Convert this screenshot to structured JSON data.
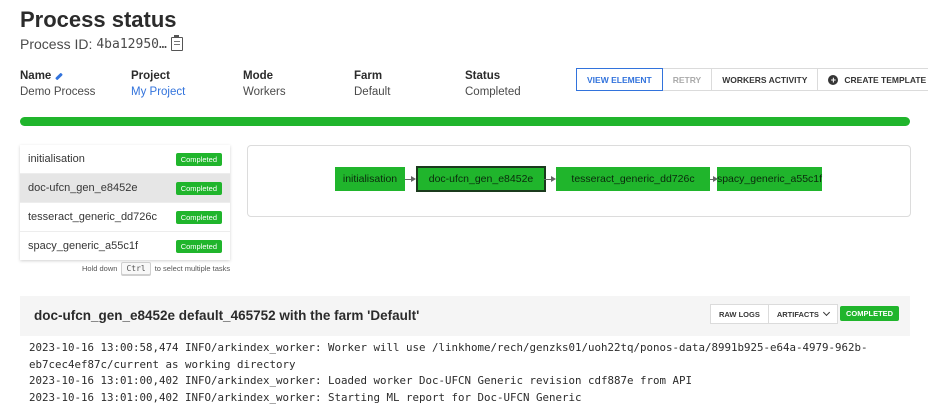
{
  "header": {
    "title": "Process status",
    "process_id_label": "Process ID:",
    "process_id": "4ba12950…"
  },
  "meta": {
    "name_label": "Name",
    "name_value": "Demo Process",
    "project_label": "Project",
    "project_value": "My Project",
    "mode_label": "Mode",
    "mode_value": "Workers",
    "farm_label": "Farm",
    "farm_value": "Default",
    "status_label": "Status",
    "status_value": "Completed"
  },
  "toolbar": {
    "view_element": "VIEW ELEMENT",
    "retry": "RETRY",
    "workers_activity": "WORKERS ACTIVITY",
    "create_template": "CREATE TEMPLATE"
  },
  "progress": {
    "value": 1.0,
    "color": "#20b52c"
  },
  "tasks": [
    {
      "name": "initialisation",
      "status": "Completed",
      "selected": false
    },
    {
      "name": "doc-ufcn_gen_e8452e",
      "status": "Completed",
      "selected": true
    },
    {
      "name": "tesseract_generic_dd726c",
      "status": "Completed",
      "selected": false
    },
    {
      "name": "spacy_generic_a55c1f",
      "status": "Completed",
      "selected": false
    }
  ],
  "hint": {
    "before": "Hold down",
    "key": "Ctrl",
    "after": "to select multiple tasks"
  },
  "graph": {
    "nodes": [
      "initialisation",
      "doc-ufcn_gen_e8452e",
      "tesseract_generic_dd726c",
      "spacy_generic_a55c1f"
    ]
  },
  "log": {
    "title": "doc-ufcn_gen_e8452e default_465752 with the farm 'Default'",
    "raw_logs": "RAW LOGS",
    "artifacts": "ARTIFACTS",
    "status": "COMPLETED",
    "lines": [
      "2023-10-16 13:00:58,474 INFO/arkindex_worker: Worker will use /linkhome/rech/genzks01/uoh22tq/ponos-data/8991b925-e64a-4979-962b-",
      "eb7cec4ef87c/current as working directory",
      "2023-10-16 13:01:00,402 INFO/arkindex_worker: Loaded worker Doc-UFCN Generic revision cdf887e from API",
      "2023-10-16 13:01:00,402 INFO/arkindex_worker: Starting ML report for Doc-UFCN Generic"
    ]
  },
  "colors": {
    "accent": "#3273dc",
    "success": "#20b52c"
  }
}
